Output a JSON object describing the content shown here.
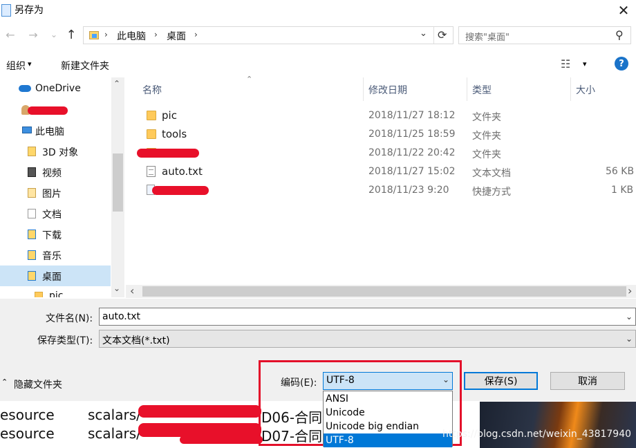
{
  "window": {
    "title": "另存为",
    "close_glyph": "✕"
  },
  "nav": {
    "back_glyph": "←",
    "forward_glyph": "→",
    "recent_glyph": "⌄",
    "up_glyph": "↑",
    "breadcrumb": [
      "此电脑",
      "桌面"
    ],
    "breadcrumb_sep": "›",
    "dropdown_glyph": "⌄",
    "refresh_glyph": "⟳",
    "search_placeholder": "搜索\"桌面\"",
    "search_glyph": "⚲"
  },
  "toolbar": {
    "organize": "组织",
    "organize_arrow": "▾",
    "new_folder": "新建文件夹",
    "view_glyph": "☷",
    "view_arrow": "▾",
    "help": "?"
  },
  "sidebar": {
    "items": [
      {
        "label": "OneDrive",
        "icon": "cloud-icon"
      },
      {
        "label": "",
        "icon": "user-icon"
      },
      {
        "label": "此电脑",
        "icon": "computer-icon"
      },
      {
        "label": "3D 对象",
        "icon": "3d-objects-icon"
      },
      {
        "label": "视频",
        "icon": "video-icon"
      },
      {
        "label": "图片",
        "icon": "pictures-icon"
      },
      {
        "label": "文档",
        "icon": "documents-icon"
      },
      {
        "label": "下载",
        "icon": "download-icon"
      },
      {
        "label": "音乐",
        "icon": "music-icon"
      },
      {
        "label": "桌面",
        "icon": "desktop-icon"
      },
      {
        "label": "pic",
        "icon": "folder-icon"
      }
    ],
    "scroll_up": "⌃",
    "scroll_down": "⌄"
  },
  "files": {
    "columns": [
      "名称",
      "修改日期",
      "类型",
      "大小"
    ],
    "sort_glyph": "⌃",
    "rows": [
      {
        "name": "pic",
        "date": "2018/11/27 18:12",
        "type": "文件夹",
        "size": ""
      },
      {
        "name": "tools",
        "date": "2018/11/25 18:59",
        "type": "文件夹",
        "size": ""
      },
      {
        "name": "",
        "date": "2018/11/22 20:42",
        "type": "文件夹",
        "size": ""
      },
      {
        "name": "auto.txt",
        "date": "2018/11/27 15:02",
        "type": "文本文档",
        "size": "56 KB"
      },
      {
        "name": "",
        "date": "2018/11/23 9:20",
        "type": "快捷方式",
        "size": "1 KB"
      }
    ],
    "hscroll_left": "‹",
    "hscroll_right": "›"
  },
  "form": {
    "filename_label": "文件名(N):",
    "filename_value": "auto.txt",
    "filetype_label": "保存类型(T):",
    "filetype_value": "文本文档(*.txt)",
    "combo_arrow": "⌄"
  },
  "footer": {
    "hide_folders": "隐藏文件夹",
    "hide_glyph": "⌃",
    "encoding_label": "编码(E):",
    "encoding_value": "UTF-8",
    "encoding_options": [
      "ANSI",
      "Unicode",
      "Unicode big endian",
      "UTF-8"
    ],
    "save": "保存(S)",
    "cancel": "取消"
  },
  "background": {
    "lines": [
      {
        "left": "esource",
        "middle": "scalars/",
        "right": "D06-合同"
      },
      {
        "left": "esource",
        "middle": "scalars/",
        "right": "D07-合同"
      }
    ],
    "watermark": "https://blog.csdn.net/weixin_43817940"
  },
  "colors": {
    "accent": "#0078d7",
    "redaction": "#e8102a",
    "highlight_box": "#e3102a"
  }
}
